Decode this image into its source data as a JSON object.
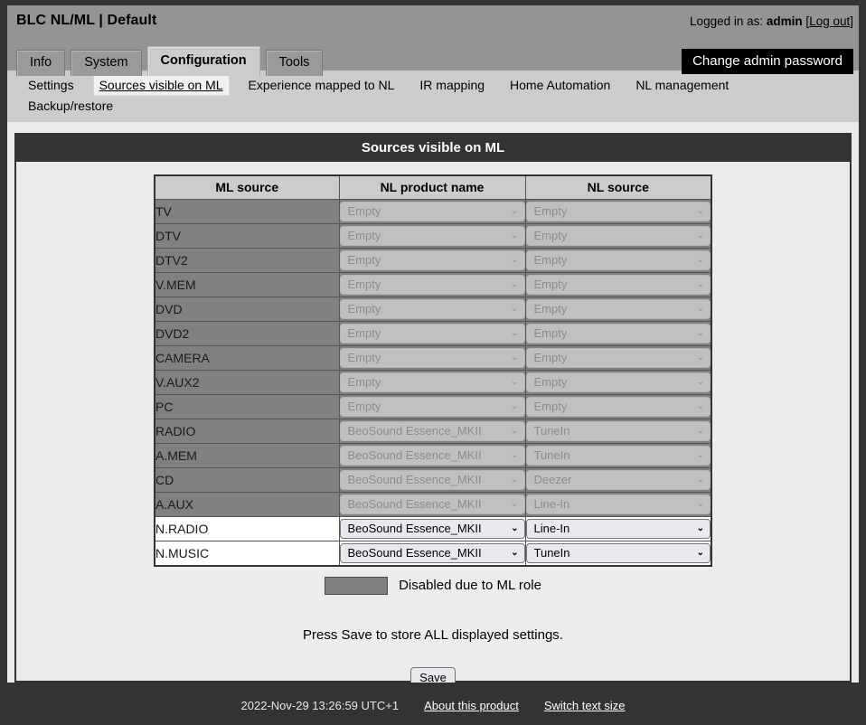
{
  "header": {
    "app_title": "BLC NL/ML | Default",
    "logged_in_prefix": "Logged in as:",
    "username": "admin",
    "logout_open": "[",
    "logout_label": "Log out",
    "logout_close": "]",
    "change_password_label": "Change admin password"
  },
  "tabs": [
    {
      "label": "Info",
      "active": false
    },
    {
      "label": "System",
      "active": false
    },
    {
      "label": "Configuration",
      "active": true
    },
    {
      "label": "Tools",
      "active": false
    }
  ],
  "subnav": [
    {
      "label": "Settings",
      "active": false
    },
    {
      "label": "Sources visible on ML",
      "active": true
    },
    {
      "label": "Experience mapped to NL",
      "active": false
    },
    {
      "label": "IR mapping",
      "active": false
    },
    {
      "label": "Home Automation",
      "active": false
    },
    {
      "label": "NL management",
      "active": false
    },
    {
      "label": "Backup/restore",
      "active": false
    }
  ],
  "panel": {
    "title": "Sources visible on ML",
    "columns": [
      "ML source",
      "NL product name",
      "NL source"
    ],
    "rows": [
      {
        "ml_source": "TV",
        "nl_product": "Empty",
        "nl_source": "Empty",
        "enabled": false
      },
      {
        "ml_source": "DTV",
        "nl_product": "Empty",
        "nl_source": "Empty",
        "enabled": false
      },
      {
        "ml_source": "DTV2",
        "nl_product": "Empty",
        "nl_source": "Empty",
        "enabled": false
      },
      {
        "ml_source": "V.MEM",
        "nl_product": "Empty",
        "nl_source": "Empty",
        "enabled": false
      },
      {
        "ml_source": "DVD",
        "nl_product": "Empty",
        "nl_source": "Empty",
        "enabled": false
      },
      {
        "ml_source": "DVD2",
        "nl_product": "Empty",
        "nl_source": "Empty",
        "enabled": false
      },
      {
        "ml_source": "CAMERA",
        "nl_product": "Empty",
        "nl_source": "Empty",
        "enabled": false
      },
      {
        "ml_source": "V.AUX2",
        "nl_product": "Empty",
        "nl_source": "Empty",
        "enabled": false
      },
      {
        "ml_source": "PC",
        "nl_product": "Empty",
        "nl_source": "Empty",
        "enabled": false
      },
      {
        "ml_source": "RADIO",
        "nl_product": "BeoSound Essence_MKII",
        "nl_source": "TuneIn",
        "enabled": false
      },
      {
        "ml_source": "A.MEM",
        "nl_product": "BeoSound Essence_MKII",
        "nl_source": "TuneIn",
        "enabled": false
      },
      {
        "ml_source": "CD",
        "nl_product": "BeoSound Essence_MKII",
        "nl_source": "Deezer",
        "enabled": false
      },
      {
        "ml_source": "A.AUX",
        "nl_product": "BeoSound Essence_MKII",
        "nl_source": "Line-In",
        "enabled": false
      },
      {
        "ml_source": "N.RADIO",
        "nl_product": "BeoSound Essence_MKII",
        "nl_source": "Line-In",
        "enabled": true
      },
      {
        "ml_source": "N.MUSIC",
        "nl_product": "BeoSound Essence_MKII",
        "nl_source": "TuneIn",
        "enabled": true
      }
    ],
    "legend_label": "Disabled due to ML role",
    "save_note": "Press Save to store ALL displayed settings.",
    "save_label": "Save"
  },
  "footer": {
    "timestamp": "2022-Nov-29 13:26:59 UTC+1",
    "about_label": "About this product",
    "text_size_label": "Switch text size"
  },
  "icons": {
    "chevron_down": "⌄"
  },
  "colors": {
    "page_frame": "#333333",
    "header_bg": "#949494",
    "subnav_bg": "#cccccc",
    "content_bg": "#ececec",
    "row_disabled": "#808080",
    "row_enabled": "#ffffff",
    "panel_header_bg": "#333333",
    "accent_button_bg": "#000000"
  }
}
